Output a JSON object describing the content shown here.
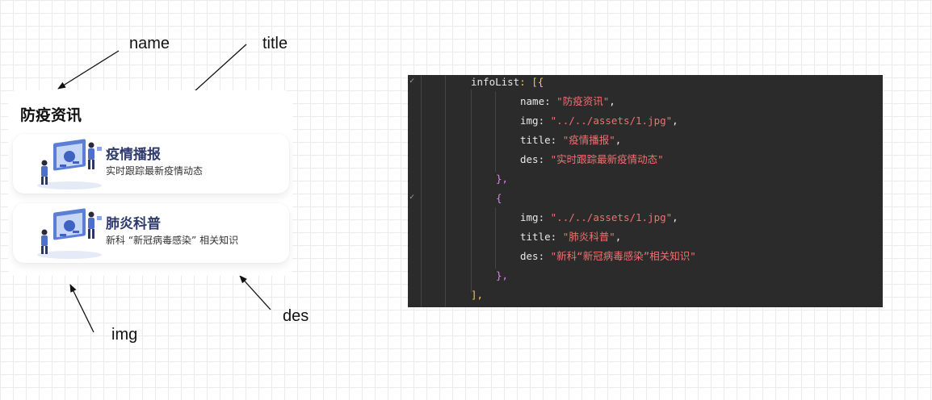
{
  "annotations": {
    "name": "name",
    "title": "title",
    "img": "img",
    "des": "des"
  },
  "panel": {
    "name": "防疫资讯",
    "items": [
      {
        "title": "疫情播报",
        "des": "实时跟踪最新疫情动态"
      },
      {
        "title": "肺炎科普",
        "des": "新科 “新冠病毒感染” 相关知识"
      }
    ]
  },
  "code": {
    "l1_key": "infoList",
    "l1_rest": ": [{",
    "l2_key": "name",
    "l2_val": "\"防疫资讯\"",
    "l3_key": "img",
    "l3_val": "\"../../assets/1.jpg\"",
    "l4_key": "title",
    "l4_val": "\"疫情播报\"",
    "l5_key": "des",
    "l5_val": "\"实时跟踪最新疫情动态\"",
    "l6": "},",
    "l7": "{",
    "l8_key": "img",
    "l8_val": "\"../../assets/1.jpg\"",
    "l9_key": "title",
    "l9_val": "\"肺炎科普\"",
    "l10_key": "des",
    "l10_val": "\"新科“新冠病毒感染”相关知识\"",
    "l11": "},",
    "l12": "],",
    "colon": ": ",
    "comma": ","
  },
  "colors": {
    "code_bg": "#2b2b2b",
    "string": "#f07070",
    "title_blue": "#2d3a6b"
  }
}
